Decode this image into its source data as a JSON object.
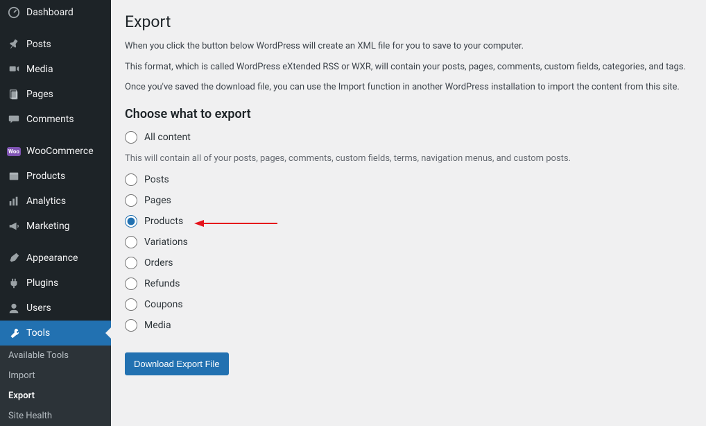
{
  "sidebar": {
    "items": [
      {
        "label": "Dashboard",
        "icon": "dashboard-icon"
      },
      {
        "label": "Posts",
        "icon": "pin-icon"
      },
      {
        "label": "Media",
        "icon": "media-icon"
      },
      {
        "label": "Pages",
        "icon": "pages-icon"
      },
      {
        "label": "Comments",
        "icon": "comments-icon"
      },
      {
        "label": "WooCommerce",
        "icon": "woocommerce-icon"
      },
      {
        "label": "Products",
        "icon": "products-icon"
      },
      {
        "label": "Analytics",
        "icon": "analytics-icon"
      },
      {
        "label": "Marketing",
        "icon": "marketing-icon"
      },
      {
        "label": "Appearance",
        "icon": "appearance-icon"
      },
      {
        "label": "Plugins",
        "icon": "plugins-icon"
      },
      {
        "label": "Users",
        "icon": "users-icon"
      },
      {
        "label": "Tools",
        "icon": "tools-icon"
      }
    ],
    "submenu": [
      {
        "label": "Available Tools"
      },
      {
        "label": "Import"
      },
      {
        "label": "Export",
        "current": true
      },
      {
        "label": "Site Health"
      }
    ]
  },
  "main": {
    "title": "Export",
    "descr1": "When you click the button below WordPress will create an XML file for you to save to your computer.",
    "descr2": "This format, which is called WordPress eXtended RSS or WXR, will contain your posts, pages, comments, custom fields, categories, and tags.",
    "descr3": "Once you've saved the download file, you can use the Import function in another WordPress installation to import the content from this site.",
    "choose_heading": "Choose what to export",
    "all_hint": "This will contain all of your posts, pages, comments, custom fields, terms, navigation menus, and custom posts.",
    "radios": [
      {
        "label": "All content",
        "checked": false
      },
      {
        "label": "Posts",
        "checked": false
      },
      {
        "label": "Pages",
        "checked": false
      },
      {
        "label": "Products",
        "checked": true
      },
      {
        "label": "Variations",
        "checked": false
      },
      {
        "label": "Orders",
        "checked": false
      },
      {
        "label": "Refunds",
        "checked": false
      },
      {
        "label": "Coupons",
        "checked": false
      },
      {
        "label": "Media",
        "checked": false
      }
    ],
    "button_label": "Download Export File"
  }
}
